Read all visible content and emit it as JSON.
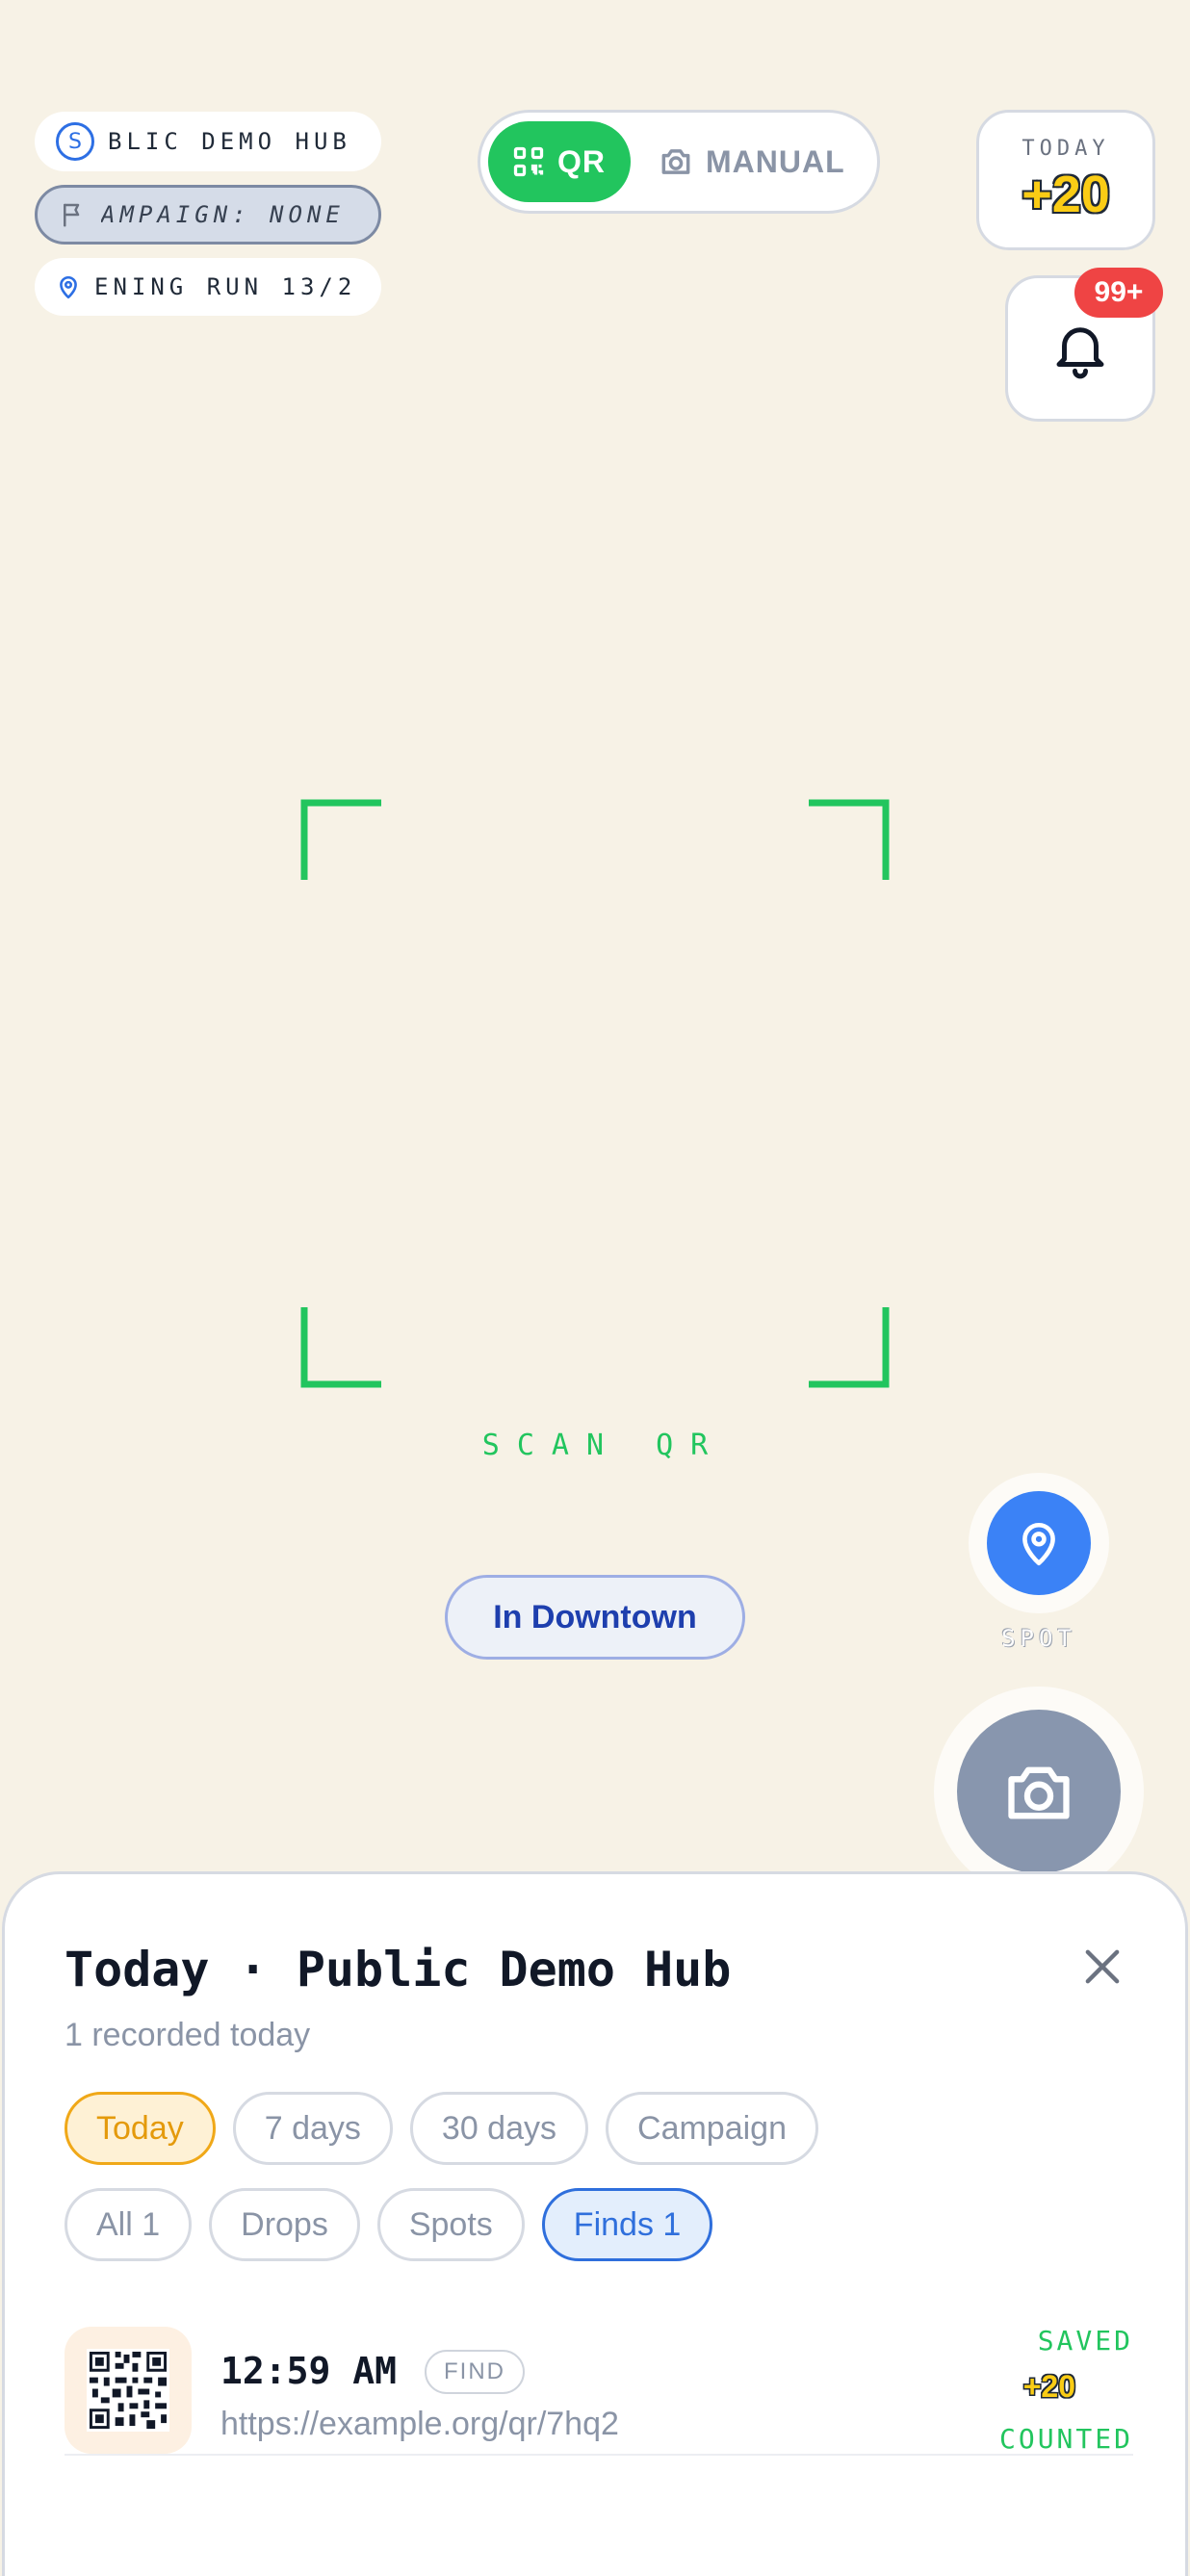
{
  "status_chips": {
    "hub": {
      "badge": "S",
      "text": "BLIC DEMO HUB"
    },
    "campaign": {
      "text": "AMPAIGN: NONE"
    },
    "run": {
      "text": "ENING RUN 13/2"
    }
  },
  "mode_toggle": {
    "qr_label": "QR",
    "manual_label": "MANUAL",
    "selected": "QR"
  },
  "today_points": {
    "label": "TODAY",
    "value": "+20"
  },
  "notifications": {
    "badge": "99+"
  },
  "scanner": {
    "label": "SCAN QR"
  },
  "location": {
    "text": "In Downtown"
  },
  "spot": {
    "label": "SPOT"
  },
  "sheet": {
    "title": "Today · Public Demo Hub",
    "subtitle": "1 recorded today",
    "time_filters": [
      "Today",
      "7 days",
      "30 days",
      "Campaign"
    ],
    "type_filters": [
      "All 1",
      "Drops",
      "Spots",
      "Finds 1"
    ],
    "selected_time": "Today",
    "selected_type": "Finds 1",
    "entries": [
      {
        "time": "12:59 AM",
        "tag": "FIND",
        "url": "https://example.org/qr/7hq2",
        "saved": "SAVED",
        "points": "+20",
        "counted": "COUNTED"
      }
    ]
  },
  "colors": {
    "background": "#f7f2e6",
    "accent_green": "#22c55e",
    "accent_blue": "#3b82f6",
    "badge_red": "#ef4444",
    "points_yellow": "#facc15",
    "filter_active_orange": "#f0a818",
    "filter_active_blue": "#2f6fdc"
  },
  "icons": {
    "hub_chip": "s-badge-icon",
    "campaign_chip": "flag-icon",
    "run_chip": "map-pin-icon",
    "qr_mode": "qr-code-icon",
    "manual_mode": "camera-icon",
    "notifications": "bell-icon",
    "spot": "map-pin-icon",
    "capture": "camera-icon",
    "close": "close-icon",
    "entry_thumb": "qr-code-icon"
  }
}
